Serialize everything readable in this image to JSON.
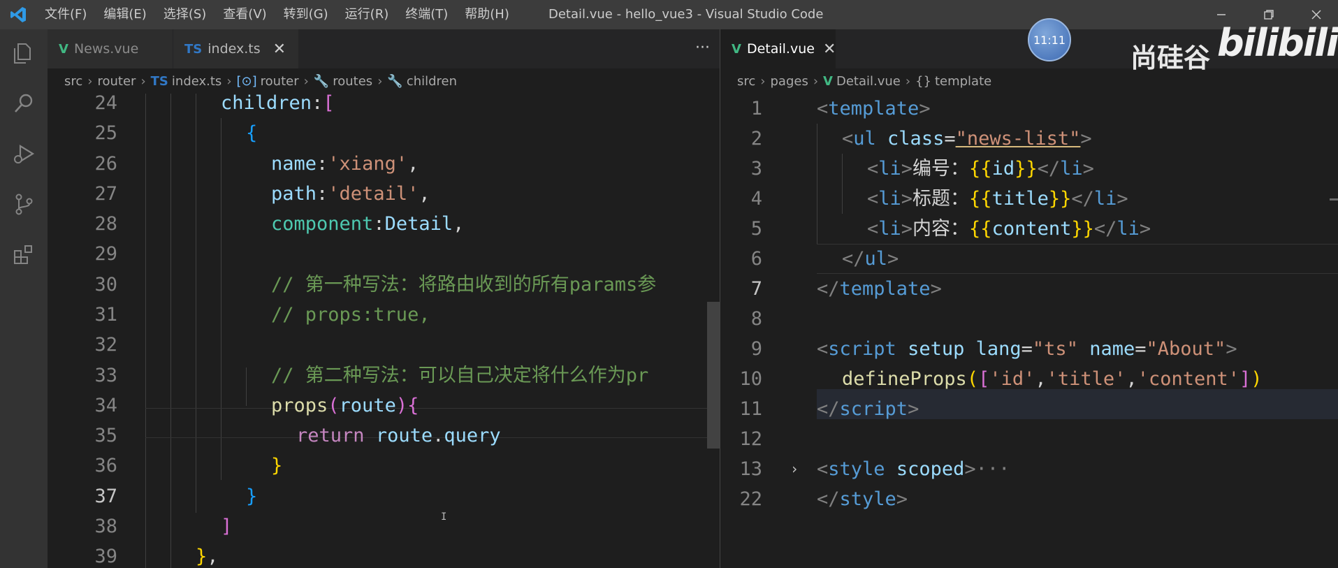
{
  "titlebar": {
    "menu": [
      "文件(F)",
      "编辑(E)",
      "选择(S)",
      "查看(V)",
      "转到(G)",
      "运行(R)",
      "终端(T)",
      "帮助(H)"
    ],
    "window_title": "Detail.vue - hello_vue3 - Visual Studio Code"
  },
  "left": {
    "tabs": [
      {
        "icon": "V",
        "label": "News.vue"
      },
      {
        "icon": "TS",
        "label": "index.ts"
      }
    ],
    "breadcrumbs": [
      "src",
      "router",
      "index.ts",
      "router",
      "routes",
      "children"
    ],
    "line_numbers": [
      "24",
      "25",
      "26",
      "27",
      "28",
      "29",
      "30",
      "31",
      "32",
      "33",
      "34",
      "35",
      "36",
      "37",
      "38",
      "39"
    ]
  },
  "right": {
    "tabs": [
      {
        "icon": "V",
        "label": "Detail.vue"
      }
    ],
    "breadcrumbs": [
      "src",
      "pages",
      "Detail.vue",
      "template"
    ],
    "line_numbers": [
      "1",
      "2",
      "3",
      "4",
      "5",
      "6",
      "7",
      "8",
      "9",
      "10",
      "11",
      "12",
      "13",
      "22"
    ]
  },
  "overlay": {
    "clock": "11:11",
    "brand_text": "尚硅谷",
    "brand_logo": "bilibili"
  },
  "colors": {
    "editor_bg": "#1e1e1e",
    "titlebar_bg": "#3c3c3c",
    "activitybar_bg": "#333333",
    "keyword": "#c586c0",
    "string": "#ce9178",
    "comment": "#6a9955",
    "tag": "#569cd6"
  }
}
